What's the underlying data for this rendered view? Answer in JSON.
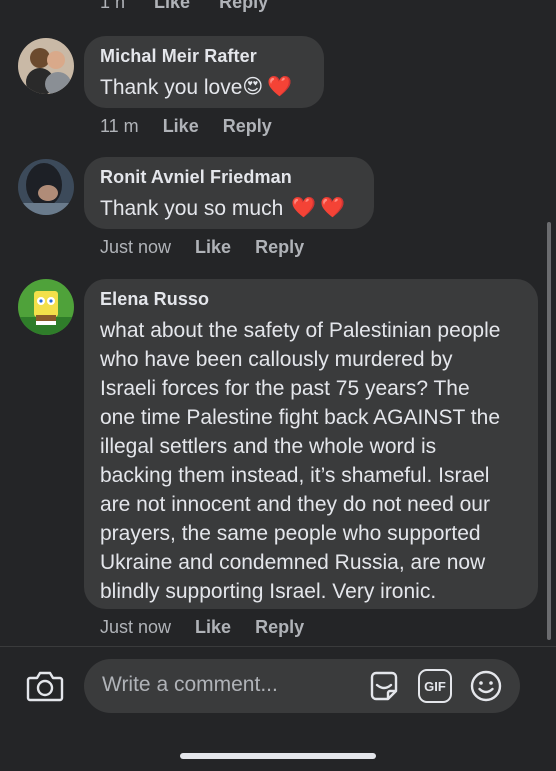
{
  "top_partial": {
    "time": "1 h",
    "like": "Like",
    "reply": "Reply"
  },
  "comments": [
    {
      "author": "Michal Meir Rafter",
      "text": "Thank you love",
      "emoji": [
        "😍",
        "❤️"
      ],
      "time": "11 m",
      "like": "Like",
      "reply": "Reply"
    },
    {
      "author": "Ronit Avniel Friedman",
      "text": "Thank you so much",
      "emoji": [
        "❤️",
        "❤️"
      ],
      "time": "Just now",
      "like": "Like",
      "reply": "Reply"
    },
    {
      "author": "Elena Russo",
      "lines": [
        "what about the safety of Palestinian people",
        "who have been callously murdered by",
        "Israeli forces for the past 75 years? The",
        "one time Palestine fight back AGAINST the",
        "illegal settlers and the whole word is",
        "backing them instead, it’s shameful. Israel",
        "are not innocent and they do not need our",
        "prayers, the same people who supported",
        "Ukraine and condemned Russia, are now",
        "blindly supporting Israel. Very ironic."
      ],
      "time": "Just now",
      "like": "Like",
      "reply": "Reply"
    }
  ],
  "composer": {
    "placeholder": "Write a comment...",
    "gif_label": "GIF"
  },
  "icons": {
    "camera": "camera-icon",
    "sticker": "sticker-icon",
    "gif": "gif-icon",
    "emoji": "smiley-icon"
  },
  "colors": {
    "background": "#242527",
    "bubble": "#3a3b3c",
    "text": "#e4e6eb",
    "secondary": "#b0b3b8"
  }
}
